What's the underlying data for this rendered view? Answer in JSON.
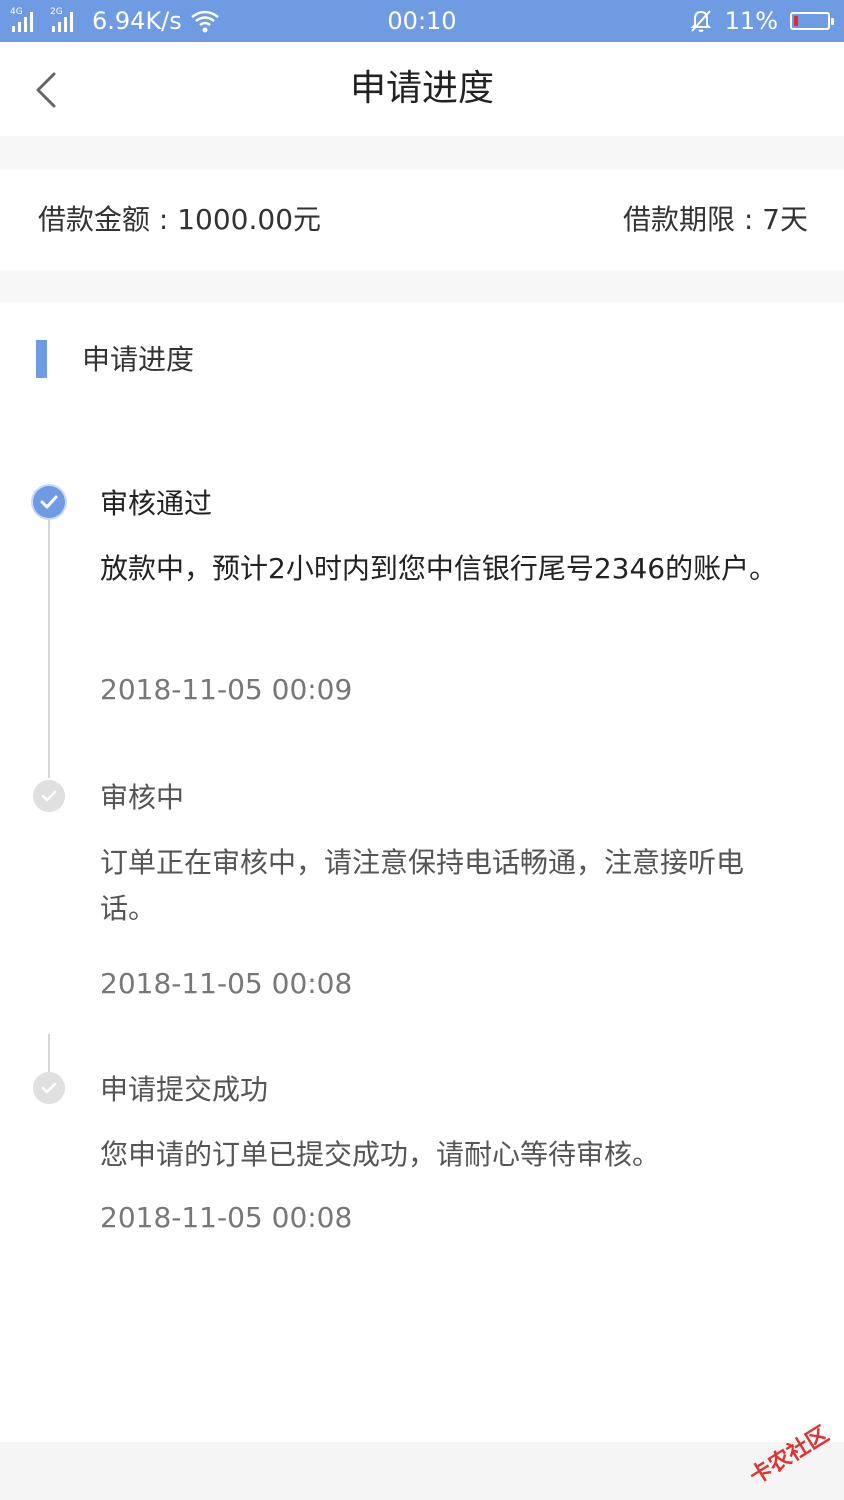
{
  "status_bar": {
    "net_tag_1": "4G",
    "net_tag_2": "2G",
    "speed": "6.94K/s",
    "time": "00:10",
    "battery": "11%",
    "battery_level": 0.11,
    "icons": [
      "signal-icon",
      "signal-icon",
      "wifi-icon",
      "bell-muted-icon",
      "battery-icon"
    ]
  },
  "nav": {
    "title": "申请进度",
    "back_icon": "chevron-left-icon"
  },
  "summary": {
    "amount": "借款金额 : 1000.00元",
    "term": "借款期限 : 7天"
  },
  "progress": {
    "section_title": "申请进度",
    "steps": [
      {
        "title": "审核通过",
        "desc": "放款中，预计2小时内到您中信银行尾号2346的账户。",
        "time": "2018-11-05 00:09",
        "status": "active"
      },
      {
        "title": "审核中",
        "desc": "订单正在审核中，请注意保持电话畅通，注意接听电话。",
        "time": "2018-11-05 00:08",
        "status": "done"
      },
      {
        "title": "申请提交成功",
        "desc": "您申请的订单已提交成功，请耐心等待审核。",
        "time": "2018-11-05 00:08",
        "status": "done"
      }
    ]
  },
  "watermark": "卡农社区",
  "colors": {
    "accent": "#6f9be3",
    "battery_low": "#e02c2c"
  }
}
